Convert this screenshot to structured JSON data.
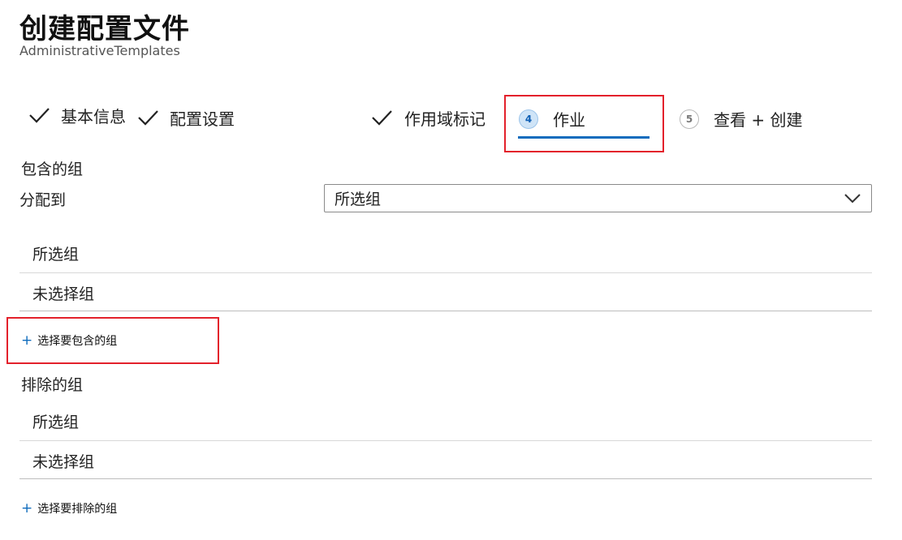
{
  "page": {
    "title": "创建配置文件",
    "subtitle": "AdministrativeTemplates"
  },
  "steps": [
    {
      "label": "基本信息",
      "state": "completed"
    },
    {
      "label": "配置设置",
      "state": "completed"
    },
    {
      "label": "作用域标记",
      "state": "completed"
    },
    {
      "number": "4",
      "label": "作业",
      "state": "current"
    },
    {
      "number": "5",
      "label": "查看 + 创建",
      "state": "pending"
    }
  ],
  "included": {
    "section_label": "包含的组",
    "assign_to_label": "分配到",
    "dropdown_value": "所选组",
    "options": [
      "所选组",
      "未选择组"
    ],
    "add_link": "选择要包含的组"
  },
  "excluded": {
    "section_label": "排除的组",
    "options": [
      "所选组",
      "未选择组"
    ],
    "add_link": "选择要排除的组"
  },
  "colors": {
    "accent": "#0f6cbd",
    "highlight": "#e3212b"
  },
  "icons": {
    "completed_step": "check-icon",
    "dropdown": "chevron-down-icon",
    "add": "plus-icon"
  }
}
